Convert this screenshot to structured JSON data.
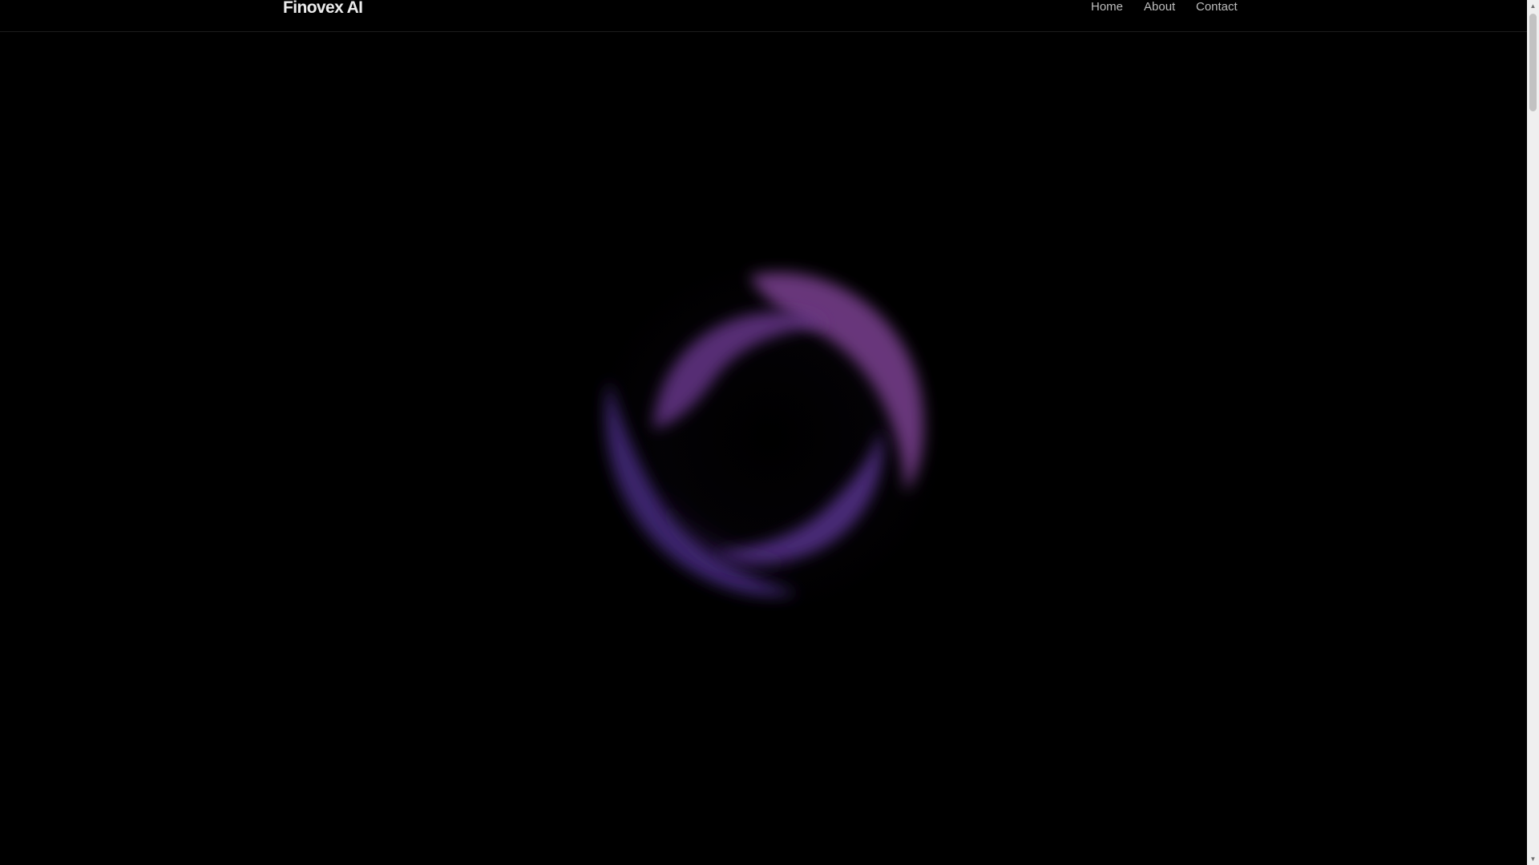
{
  "header": {
    "brand": "Finovex AI",
    "nav": [
      {
        "label": "Home"
      },
      {
        "label": "About"
      },
      {
        "label": "Contact"
      }
    ]
  },
  "hero": {
    "orb_colors": [
      "#6a3990",
      "#7a3f8f",
      "#5a3493",
      "#452a7e"
    ]
  },
  "scrollbar": {
    "up_icon": "triangle-up",
    "down_icon": "triangle-down",
    "position": 0
  },
  "theme": {
    "background": "#000000",
    "text": "#ececec",
    "nav_text": "#bdbdbd"
  }
}
